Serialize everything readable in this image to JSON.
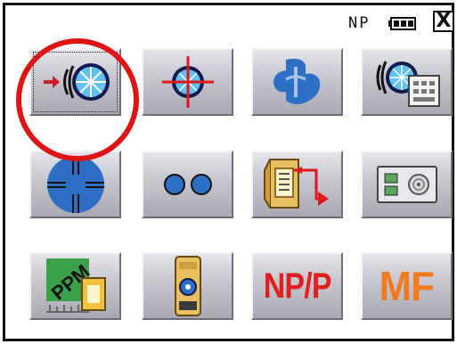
{
  "status": {
    "prism_mode": "NP",
    "battery_icon": "battery-icon"
  },
  "close": {
    "label": "X",
    "icon": "close-icon"
  },
  "menu": {
    "rows": [
      [
        "edm-measure-icon",
        "target-crosshair-icon",
        "blue-emblem-icon",
        "edm-memory-icon"
      ],
      [
        "reticle-circle-icon",
        "two-dots-icon",
        "card-transfer-icon",
        "memory-card-icon"
      ],
      [
        "ppm-atmosphere-icon",
        "tilt-level-icon",
        "np-p-toggle",
        "mf-toggle"
      ]
    ],
    "selected": "edm-measure-icon"
  },
  "text_icons": {
    "np_p": "NP/P",
    "mf": "MF",
    "ppm": "PPM"
  },
  "colors": {
    "highlight_ring": "#e01414",
    "accent_blue": "#2c6fc4",
    "np_red": "#e02020",
    "mf_orange": "#f07a20"
  }
}
